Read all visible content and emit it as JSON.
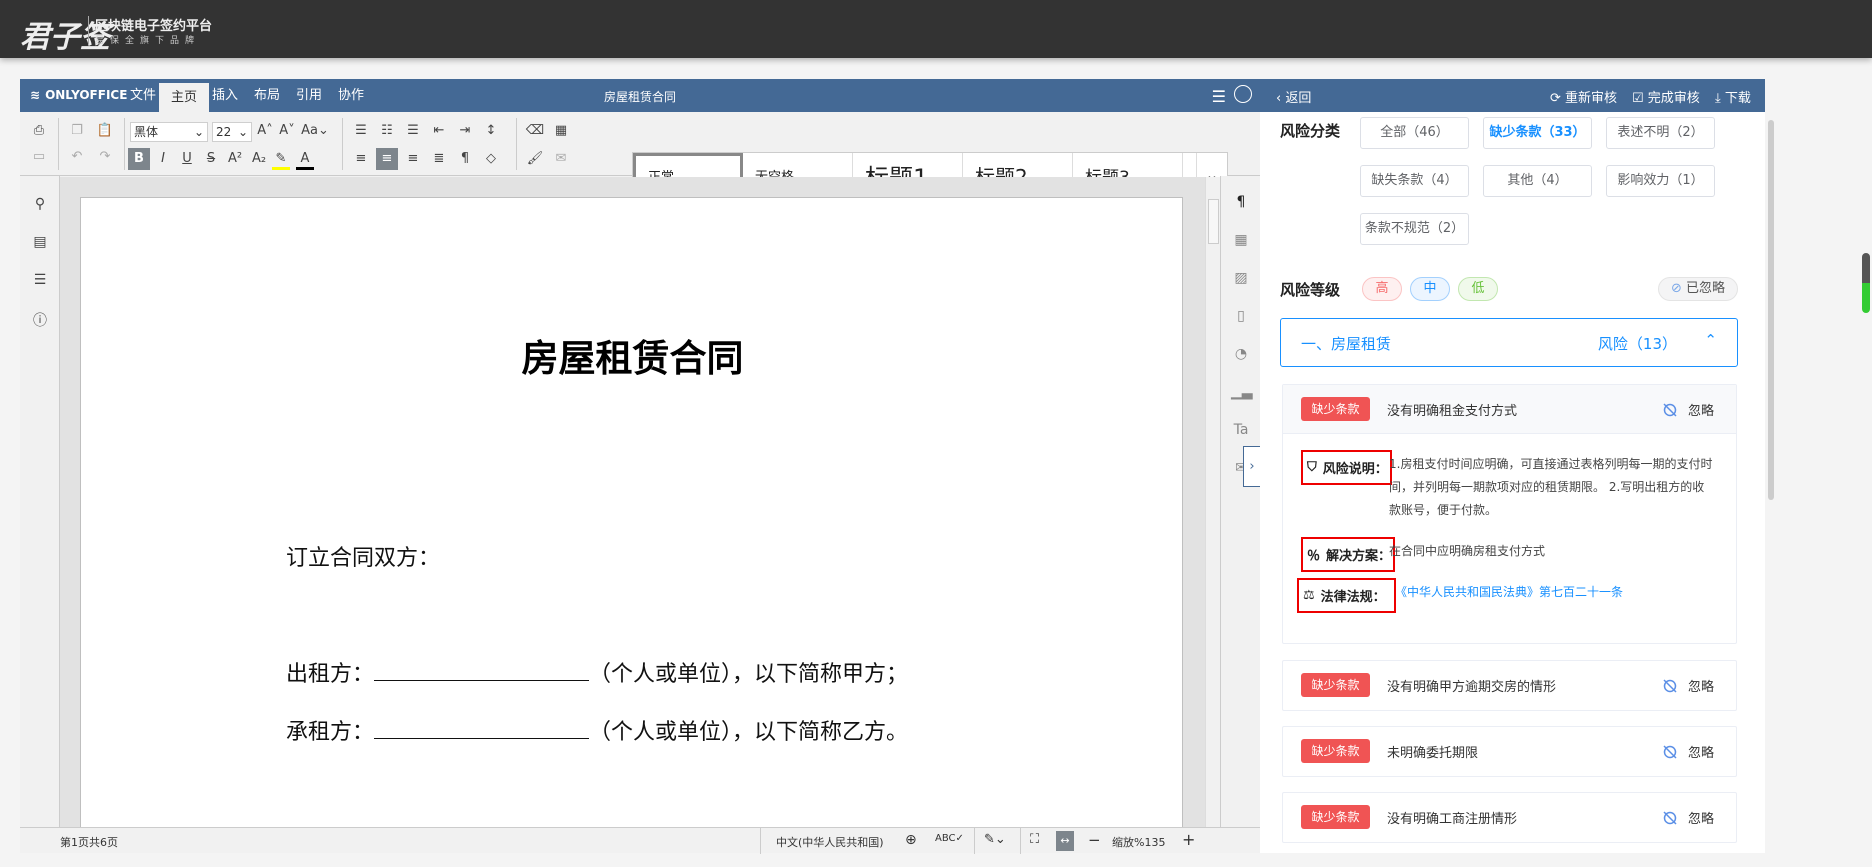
{
  "brand": {
    "logo": "君子签",
    "title": "区块链电子签约平台",
    "subtitle": "易保全旗下品牌"
  },
  "editor": {
    "product": "ONLYOFFICE",
    "tabs": [
      {
        "label": "文件"
      },
      {
        "label": "主页",
        "active": true
      },
      {
        "label": "插入"
      },
      {
        "label": "布局"
      },
      {
        "label": "引用"
      },
      {
        "label": "协作"
      }
    ],
    "doc_title": "房屋租赁合同",
    "font_name": "黑体",
    "font_size": "22",
    "styles": [
      "正常",
      "无空格",
      "标题1",
      "标题2",
      "标题3"
    ],
    "status": {
      "page": "第1页共6页",
      "language": "中文(中华人民共和国)",
      "zoom": "缩放%135"
    }
  },
  "document": {
    "heading": "房屋租赁合同",
    "line1": "订立合同双方：",
    "line2a": "出租方：",
    "line2b": "（个人或单位），以下简称甲方；",
    "line3a": "承租方：",
    "line3b": "（个人或单位），以下简称乙方。"
  },
  "panel": {
    "back": "返回",
    "recheck": "重新审核",
    "complete": "完成审核",
    "download": "下载",
    "category_label": "风险分类",
    "categories": [
      {
        "label": "全部（46）"
      },
      {
        "label": "缺少条款（33）",
        "active": true
      },
      {
        "label": "表述不明（2）"
      },
      {
        "label": "缺失条款（4）"
      },
      {
        "label": "其他（4）"
      },
      {
        "label": "影响效力（1）"
      },
      {
        "label": "条款不规范（2）"
      }
    ],
    "level_label": "风险等级",
    "levels": [
      {
        "label": "高",
        "color": "#f56c6c"
      },
      {
        "label": "中",
        "color": "#1890ff"
      },
      {
        "label": "低",
        "color": "#67c23a"
      }
    ],
    "ignored": "已忽略",
    "section": {
      "title": "一、房屋租赁",
      "count": "风险（13）"
    },
    "ignore_label": "忽略",
    "expanded": {
      "tag": "缺少条款",
      "title": "没有明确租金支付方式",
      "risk_label": "风险说明：",
      "risk_text": "1.房租支付时间应明确，可直接通过表格列明每一期的支付时间，并列明每一期款项对应的租赁期限。 2.写明出租方的收款账号，便于付款。",
      "solution_label": "解决方案：",
      "solution_text": "在合同中应明确房租支付方式",
      "law_label": "法律法规：",
      "law_text": "《中华人民共和国民法典》第七百二十一条"
    },
    "items": [
      {
        "tag": "缺少条款",
        "title": "没有明确甲方逾期交房的情形"
      },
      {
        "tag": "缺少条款",
        "title": "未明确委托期限"
      },
      {
        "tag": "缺少条款",
        "title": "没有明确工商注册情形"
      }
    ]
  },
  "colors": {
    "header_blue": "#446995",
    "accent": "#1890ff",
    "tag_red": "#f05454"
  }
}
